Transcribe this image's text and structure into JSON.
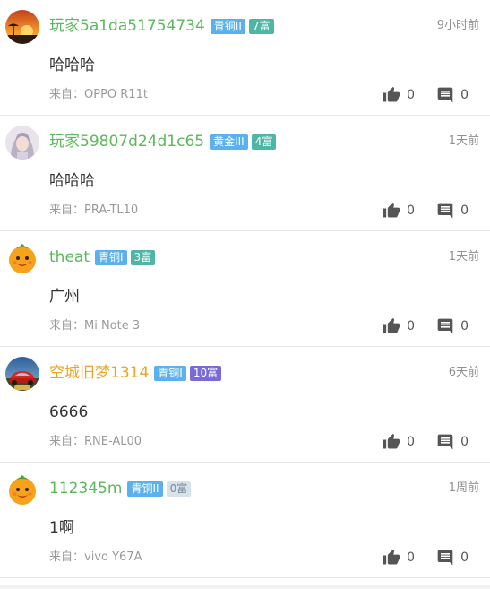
{
  "source_prefix": "来自：",
  "posts": [
    {
      "username": "玩家5a1da51754734",
      "rank_badge": "青铜II",
      "wealth_badge": "7富",
      "time": "9小时前",
      "content": "哈哈哈",
      "source": "来自：OPPO R11t",
      "likes": "0",
      "comments": "0"
    },
    {
      "username": "玩家59807d24d1c65",
      "rank_badge": "黄金III",
      "wealth_badge": "4富",
      "time": "1天前",
      "content": "哈哈哈",
      "source": "来自：PRA-TL10",
      "likes": "0",
      "comments": "0"
    },
    {
      "username": "theat",
      "rank_badge": "青铜I",
      "wealth_badge": "3富",
      "time": "1天前",
      "content": "广州",
      "source": "来自：Mi Note 3",
      "likes": "0",
      "comments": "0"
    },
    {
      "username": "空城旧梦1314",
      "rank_badge": "青铜I",
      "wealth_badge": "10富",
      "time": "6天前",
      "content": "6666",
      "source": "来自：RNE-AL00",
      "likes": "0",
      "comments": "0"
    },
    {
      "username": "112345m",
      "rank_badge": "青铜II",
      "wealth_badge": "0富",
      "time": "1周前",
      "content": "1啊",
      "source": "来自：vivo Y67A",
      "likes": "0",
      "comments": "0"
    }
  ],
  "colors": {
    "username_green": "#5cb85c",
    "username_gold": "#f0a324",
    "rank_badge_blue": "#5ab1ee",
    "wealth_badge_teal": "#4db6a4",
    "wealth_badge_purple": "#7a6ad8",
    "wealth_badge_zero": "#d7e2ec"
  },
  "icons": {
    "like": "thumbs-up-icon",
    "comment": "comment-icon"
  }
}
